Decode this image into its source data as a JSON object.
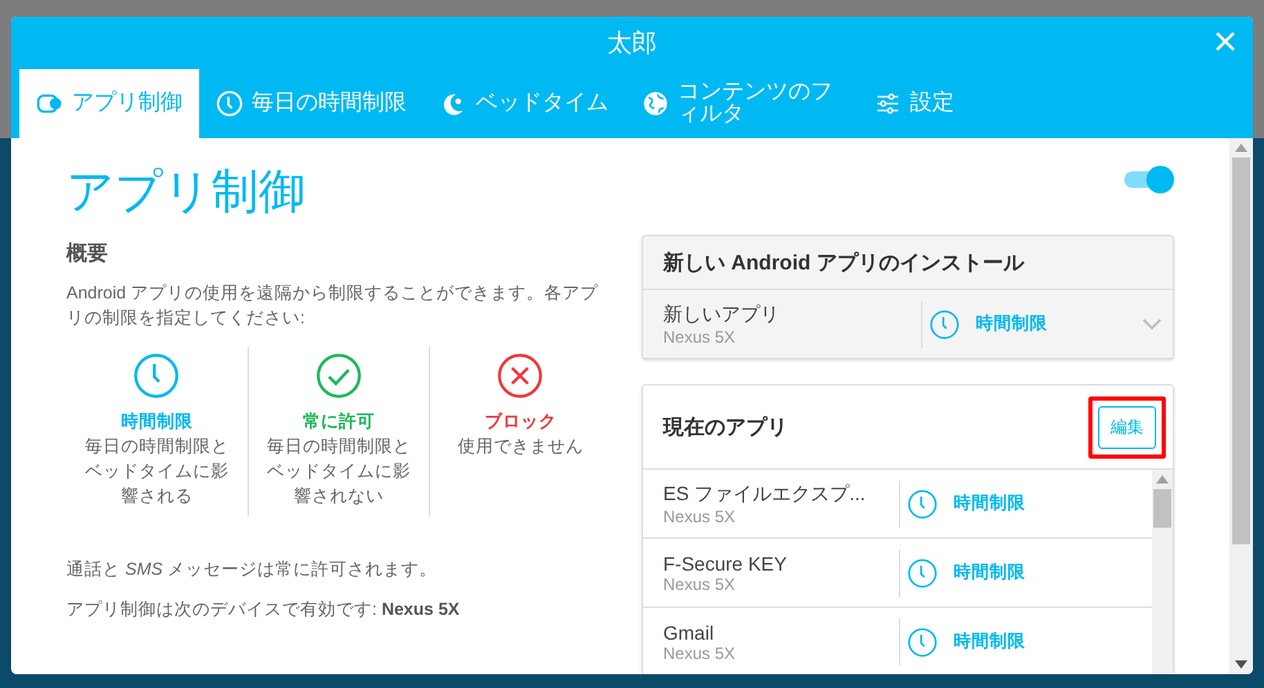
{
  "window": {
    "title": "太郎"
  },
  "tabs": [
    {
      "label": "アプリ制御",
      "kind": "app",
      "selected": true
    },
    {
      "label": "毎日の時間制限",
      "kind": "clock",
      "selected": false
    },
    {
      "label": "ベッドタイム",
      "kind": "moon",
      "selected": false
    },
    {
      "label": "コンテンツのフィルタ",
      "kind": "globe",
      "selected": false
    },
    {
      "label": "設定",
      "kind": "sliders",
      "selected": false
    }
  ],
  "page": {
    "title": "アプリ制御",
    "toggle": {
      "on": true
    },
    "overview_heading": "概要",
    "description": "Android アプリの使用を遠隔から制限することができます。各アプリの制限を指定してください:",
    "modes": [
      {
        "kind": "time",
        "label": "時間制限",
        "description": "毎日の時間制限とベッドタイムに影響される"
      },
      {
        "kind": "allow",
        "label": "常に許可",
        "description": "毎日の時間制限とベッドタイムに影響されない"
      },
      {
        "kind": "block",
        "label": "ブロック",
        "description": "使用できません"
      }
    ],
    "notes": [
      "通話と *SMS* メッセージは常に許可されます。",
      "アプリ制御は次のデバイスで有効です: **Nexus 5X**"
    ]
  },
  "new_install": {
    "heading": "新しい Android アプリのインストール",
    "app": {
      "name": "新しいアプリ",
      "device": "Nexus 5X",
      "restriction": {
        "kind": "time",
        "label": "時間制限"
      }
    }
  },
  "current_apps": {
    "heading": "現在のアプリ",
    "edit_button": {
      "label": "編集",
      "highlighted": true
    },
    "apps": [
      {
        "name": "ES ファイルエクスプ...",
        "device": "Nexus 5X",
        "restriction": {
          "kind": "time",
          "label": "時間制限"
        }
      },
      {
        "name": "F-Secure KEY",
        "device": "Nexus 5X",
        "restriction": {
          "kind": "time",
          "label": "時間制限"
        }
      },
      {
        "name": "Gmail",
        "device": "Nexus 5X",
        "restriction": {
          "kind": "time",
          "label": "時間制限"
        }
      }
    ]
  }
}
